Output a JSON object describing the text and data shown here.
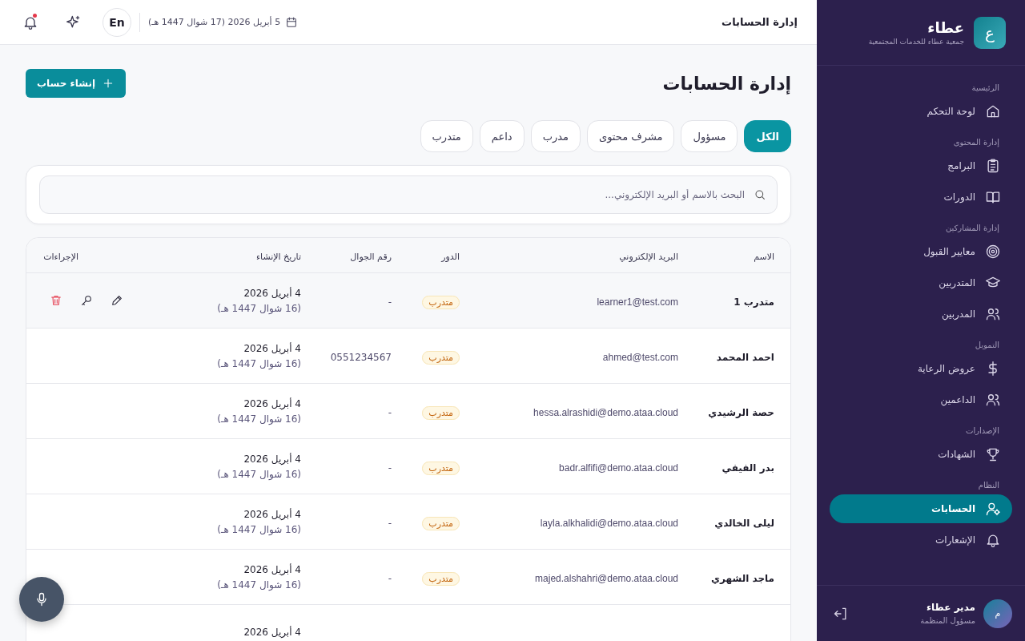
{
  "sidebar": {
    "brand": {
      "logo": "ع",
      "name": "عطاء",
      "subtitle": "جمعية عطاء للخدمات المجتمعية"
    },
    "sections": [
      {
        "title": "الرئيسية",
        "items": [
          {
            "label": "لوحة التحكم",
            "selected": false
          }
        ]
      },
      {
        "title": "إدارة المحتوى",
        "items": [
          {
            "label": "البرامج",
            "selected": false
          },
          {
            "label": "الدورات",
            "selected": false
          }
        ]
      },
      {
        "title": "إدارة المشاركين",
        "items": [
          {
            "label": "معايير القبول",
            "selected": false
          },
          {
            "label": "المتدربين",
            "selected": false
          },
          {
            "label": "المدربين",
            "selected": false
          }
        ]
      },
      {
        "title": "التمويل",
        "items": [
          {
            "label": "عروض الرعاية",
            "selected": false
          },
          {
            "label": "الداعمين",
            "selected": false
          }
        ]
      },
      {
        "title": "الإصدارات",
        "items": [
          {
            "label": "الشهادات",
            "selected": false
          }
        ]
      },
      {
        "title": "النظام",
        "items": [
          {
            "label": "الحسابات",
            "selected": true
          },
          {
            "label": "الإشعارات",
            "selected": false
          }
        ]
      }
    ],
    "user": {
      "avatar": "م",
      "name": "مدير عطاء",
      "role": "مسؤول المنظمة"
    }
  },
  "topbar": {
    "title": "إدارة الحسابات",
    "date": "5 أبريل 2026 (17 شوال 1447 هـ)",
    "language": "En",
    "has_unread_notifications": true
  },
  "page": {
    "title": "إدارة الحسابات",
    "create_button": "إنشاء حساب"
  },
  "filters": [
    {
      "label": "الكل",
      "selected": true
    },
    {
      "label": "مسؤول",
      "selected": false
    },
    {
      "label": "مشرف محتوى",
      "selected": false
    },
    {
      "label": "مدرب",
      "selected": false
    },
    {
      "label": "داعم",
      "selected": false
    },
    {
      "label": "متدرب",
      "selected": false
    }
  ],
  "search": {
    "placeholder": "البحث بالاسم أو البريد الإلكتروني..."
  },
  "table": {
    "columns": [
      "الاسم",
      "البريد الإلكتروني",
      "الدور",
      "رقم الجوال",
      "تاريخ الإنشاء",
      "الإجراءات"
    ],
    "rows": [
      {
        "name": "متدرب 1",
        "email": "learner1@test.com",
        "role": "متدرب",
        "phone": "-",
        "date": "4 أبريل 2026",
        "hijri": "(16 شوال 1447 هـ)",
        "hovered": true
      },
      {
        "name": "احمد المحمد",
        "email": "ahmed@test.com",
        "role": "متدرب",
        "phone": "0551234567",
        "date": "4 أبريل 2026",
        "hijri": "(16 شوال 1447 هـ)",
        "hovered": false
      },
      {
        "name": "حصة الرشيدي",
        "email": "hessa.alrashidi@demo.ataa.cloud",
        "role": "متدرب",
        "phone": "-",
        "date": "4 أبريل 2026",
        "hijri": "(16 شوال 1447 هـ)",
        "hovered": false
      },
      {
        "name": "بدر الفيفي",
        "email": "badr.alfifi@demo.ataa.cloud",
        "role": "متدرب",
        "phone": "-",
        "date": "4 أبريل 2026",
        "hijri": "(16 شوال 1447 هـ)",
        "hovered": false
      },
      {
        "name": "ليلى الخالدي",
        "email": "layla.alkhalidi@demo.ataa.cloud",
        "role": "متدرب",
        "phone": "-",
        "date": "4 أبريل 2026",
        "hijri": "(16 شوال 1447 هـ)",
        "hovered": false
      },
      {
        "name": "ماجد الشهري",
        "email": "majed.alshahri@demo.ataa.cloud",
        "role": "متدرب",
        "phone": "-",
        "date": "4 أبريل 2026",
        "hijri": "(16 شوال 1447 هـ)",
        "hovered": false
      },
      {
        "date": "4 أبريل 2026",
        "hovered": false
      }
    ]
  }
}
